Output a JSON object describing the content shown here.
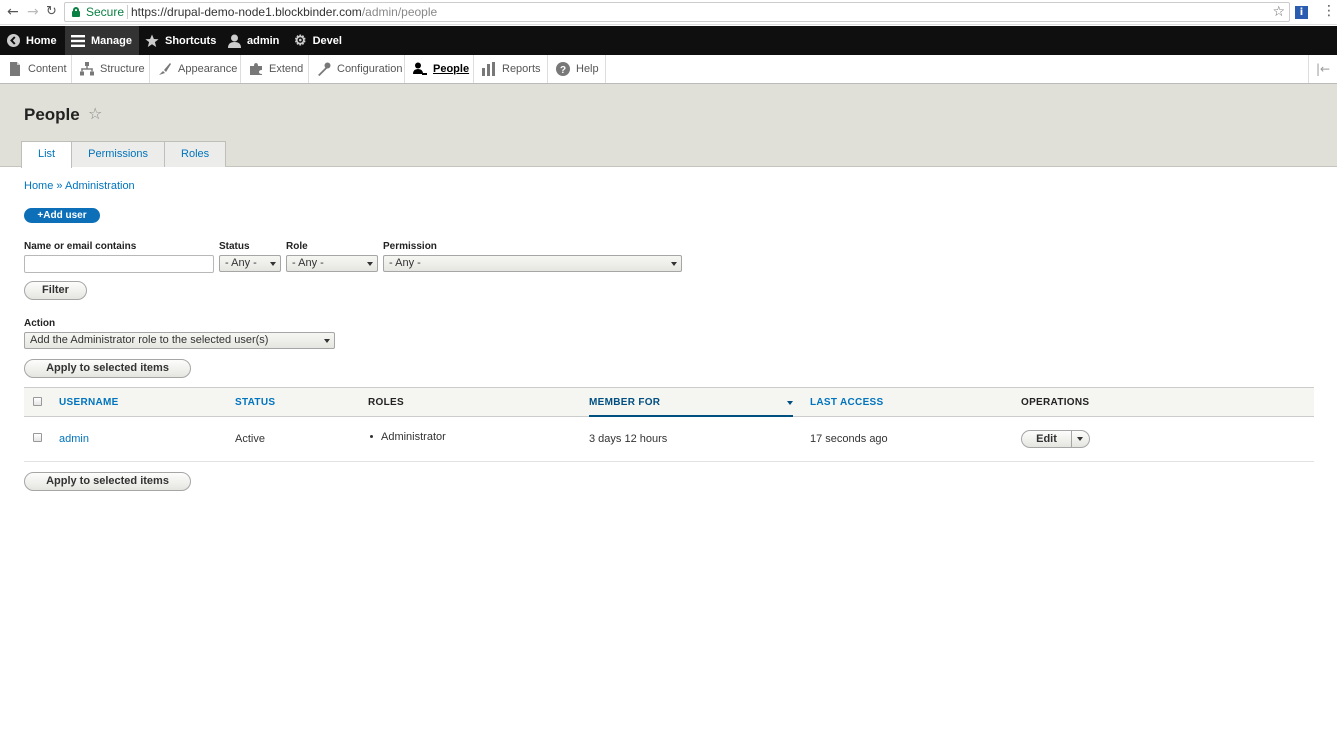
{
  "browser": {
    "secure_label": "Secure",
    "url_base": "https://drupal-demo-node1.blockbinder.com",
    "url_path": "/admin/people",
    "ext_label": "i"
  },
  "toolbar": {
    "home": "Home",
    "manage": "Manage",
    "shortcuts": "Shortcuts",
    "user": "admin",
    "devel": "Devel"
  },
  "tray": {
    "content": "Content",
    "structure": "Structure",
    "appearance": "Appearance",
    "extend": "Extend",
    "configuration": "Configuration",
    "people": "People",
    "reports": "Reports",
    "help": "Help"
  },
  "page": {
    "title": "People",
    "tabs": [
      "List",
      "Permissions",
      "Roles"
    ]
  },
  "breadcrumb": {
    "home": "Home",
    "separator": "»",
    "admin": "Administration"
  },
  "add_user": "+Add user",
  "filters": {
    "name_label": "Name or email contains",
    "name_value": "",
    "status_label": "Status",
    "status_value": "- Any -",
    "role_label": "Role",
    "role_value": "- Any -",
    "permission_label": "Permission",
    "permission_value": "- Any -",
    "filter_button": "Filter"
  },
  "action": {
    "label": "Action",
    "value": "Add the Administrator role to the selected user(s)",
    "apply_button": "Apply to selected items"
  },
  "table": {
    "headers": {
      "username": "USERNAME",
      "status": "STATUS",
      "roles": "ROLES",
      "member_for": "MEMBER FOR",
      "last_access": "LAST ACCESS",
      "operations": "OPERATIONS"
    },
    "rows": [
      {
        "username": "admin",
        "status": "Active",
        "role": "Administrator",
        "member_for": "3 days 12 hours",
        "last_access": "17 seconds ago",
        "operation": "Edit"
      }
    ]
  },
  "colors": {
    "toolbar_bg": "#0f0f0f",
    "link": "#0074bd",
    "primary_button": "#0c6fb8",
    "header_bg": "#e0e0d8",
    "secure_green": "#0b8043"
  }
}
